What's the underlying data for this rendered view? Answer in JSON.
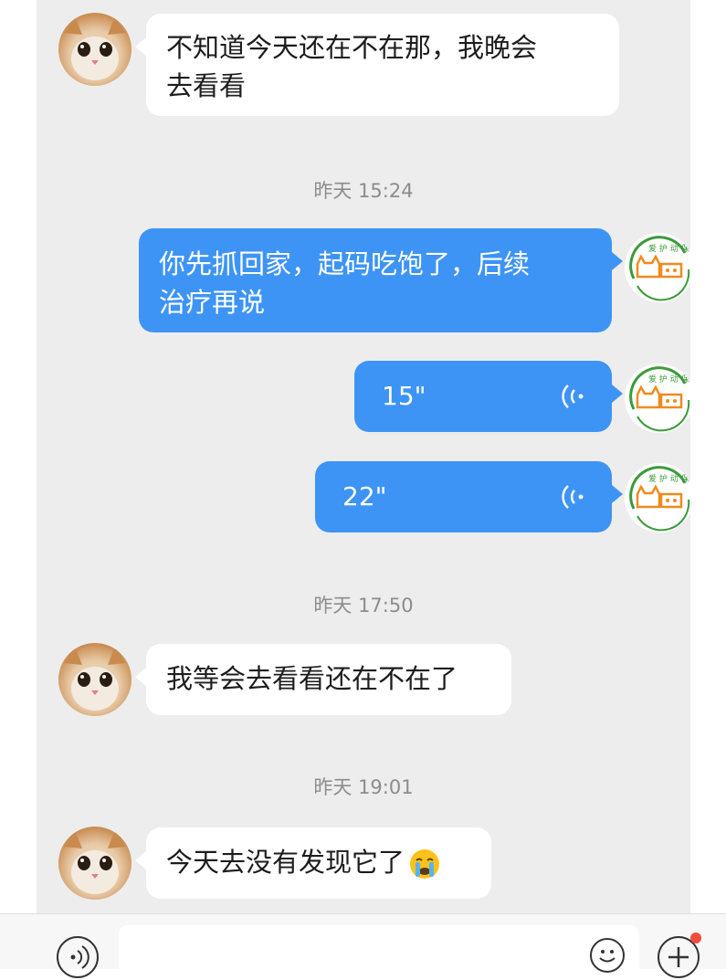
{
  "messages": [
    {
      "text": "不知道今天还在不在那，我晚会去看看",
      "line1": "不知道今天还在不在那，我晚会",
      "line2": "去看看"
    },
    {
      "text": "你先抓回家，起码吃饱了，后续治疗再说",
      "line1": "你先抓回家，起码吃饱了，后续",
      "line2": "治疗再说"
    },
    {
      "duration": "15\""
    },
    {
      "duration": "22\""
    },
    {
      "text": "我等会去看看还在不在了"
    },
    {
      "text": "今天去没有发现它了",
      "emoji": "crying-face"
    }
  ],
  "timestamps": [
    "昨天 15:24",
    "昨天 17:50",
    "昨天 19:01"
  ],
  "colors": {
    "outgoing_bubble": "#3d94f5",
    "incoming_bubble": "#ffffff",
    "background": "#ededed"
  },
  "icons": [
    "voice-mode-icon",
    "emoji-icon",
    "plus-icon",
    "voice-wave-icon",
    "crying-face-emoji"
  ],
  "avatars": {
    "contact": "cat-photo",
    "self": "pet-rescue-logo"
  }
}
